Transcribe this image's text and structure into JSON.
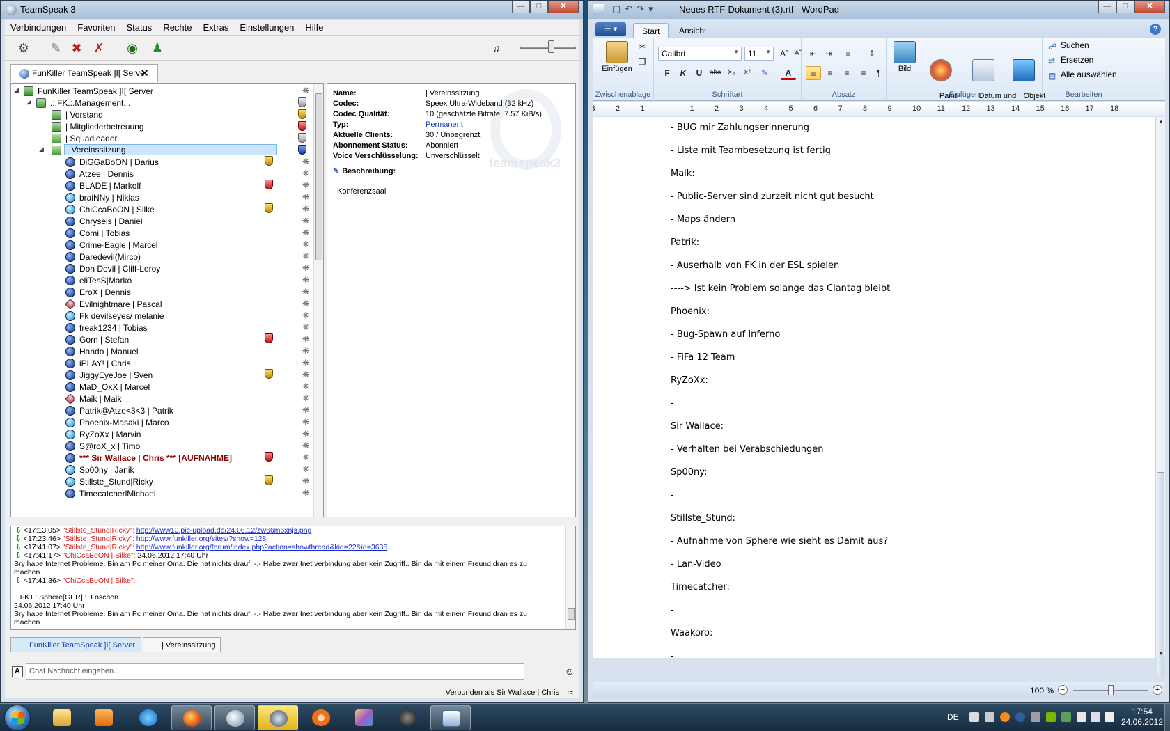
{
  "teamspeak": {
    "title": "TeamSpeak 3",
    "menu": [
      "Verbindungen",
      "Favoriten",
      "Status",
      "Rechte",
      "Extras",
      "Einstellungen",
      "Hilfe"
    ],
    "tab_label": "FunKiller TeamSpeak ]I[ Server",
    "tree": {
      "server": "FunKiller TeamSpeak ]I[ Server",
      "group": ".:.FK.:.Management.:.",
      "channels": [
        "| Vorstand",
        "| Mitgliederbetreuung",
        "| Squadleader",
        "| Vereinssitzung"
      ],
      "users": [
        {
          "name": "DiGGaBoON | Darius",
          "badge": "gold",
          "status": "normal"
        },
        {
          "name": "Atzee | Dennis",
          "badge": "",
          "status": "normal"
        },
        {
          "name": "BLADE | Markolf",
          "badge": "red",
          "status": "normal"
        },
        {
          "name": "braiNNy | Niklas",
          "badge": "",
          "status": "talk"
        },
        {
          "name": "ChiCcaBoON | Silke",
          "badge": "gold",
          "status": "talk"
        },
        {
          "name": "Chryseis | Daniel",
          "badge": "",
          "status": "normal"
        },
        {
          "name": "Comi | Tobias",
          "badge": "",
          "status": "normal"
        },
        {
          "name": "Crime-Eagle | Marcel",
          "badge": "",
          "status": "normal"
        },
        {
          "name": "Daredevil(Mirco)",
          "badge": "",
          "status": "normal"
        },
        {
          "name": "Don Devil | Cliff-Leroy",
          "badge": "",
          "status": "normal"
        },
        {
          "name": "eliTesS|Marko",
          "badge": "",
          "status": "normal"
        },
        {
          "name": "EroX | Dennis",
          "badge": "",
          "status": "normal"
        },
        {
          "name": "Evilnightmare | Pascal",
          "badge": "",
          "status": "away"
        },
        {
          "name": "Fk devilseyes/ melanie",
          "badge": "",
          "status": "talk"
        },
        {
          "name": "freak1234 | Tobias",
          "badge": "",
          "status": "normal"
        },
        {
          "name": "Gorn | Stefan",
          "badge": "red",
          "status": "normal"
        },
        {
          "name": "Hando | Manuel",
          "badge": "",
          "status": "normal"
        },
        {
          "name": "iPLAY! | Chris",
          "badge": "",
          "status": "normal"
        },
        {
          "name": "JiggyEyeJoe | Sven",
          "badge": "gold",
          "status": "normal"
        },
        {
          "name": "MaD_OxX | Marcel",
          "badge": "",
          "status": "normal"
        },
        {
          "name": "Maik | Maik",
          "badge": "",
          "status": "away"
        },
        {
          "name": "Patrik@Atze<3<3 | Patrik",
          "badge": "",
          "status": "normal"
        },
        {
          "name": "Phoenix-Masaki |  Marco",
          "badge": "",
          "status": "talk"
        },
        {
          "name": "RyZoXx | Marvin",
          "badge": "",
          "status": "talk"
        },
        {
          "name": "S@roX_x | Timo",
          "badge": "",
          "status": "normal"
        },
        {
          "name": "*** Sir Wallace | Chris *** [AUFNAHME]",
          "badge": "red",
          "status": "normal"
        },
        {
          "name": "Sp00ny | Janik",
          "badge": "",
          "status": "talk"
        },
        {
          "name": "Stillste_Stund|Ricky",
          "badge": "gold",
          "status": "talk"
        },
        {
          "name": "TimecatcherlMichael",
          "badge": "",
          "status": "normal"
        }
      ]
    },
    "info": {
      "rows": [
        {
          "k": "Name:",
          "v": "| Vereinssitzung"
        },
        {
          "k": "Codec:",
          "v": "Speex Ultra-Wideband (32 kHz)"
        },
        {
          "k": "Codec Qualität:",
          "v": "10 (geschätzte Bitrate: 7.57 KiB/s)"
        },
        {
          "k": "Typ:",
          "v": "Permanent"
        },
        {
          "k": "Aktuelle Clients:",
          "v": "30 / Unbegrenzt"
        },
        {
          "k": "Abonnement Status:",
          "v": "Abonniert"
        },
        {
          "k": "Voice Verschlüsselung:",
          "v": "Unverschlüsselt"
        }
      ],
      "logo_text": "teamspeak3",
      "desc_label": "Beschreibung:",
      "desc_text": "Konferenzsaal"
    },
    "chat": {
      "lines": [
        {
          "time": "<17:13:05>",
          "who": "\"Stillste_Stund|Ricky\":",
          "link": "http://www10.pic-upload.de/24.06.12/zw66m6xnjs.png",
          "text": ""
        },
        {
          "time": "<17:23:46>",
          "who": "\"Stillste_Stund|Ricky\":",
          "link": "http://www.funkiller.org/sites/?show=128",
          "text": ""
        },
        {
          "time": "<17:41:07>",
          "who": "\"Stillste_Stund|Ricky\":",
          "link": "http://www.funkiller.org/forum/index.php?action=showthread&kid=22&id=3635",
          "text": ""
        },
        {
          "time": "<17:41:17>",
          "who": "\"ChiCcaBoON | Silke\":",
          "link": "",
          "text": "24.06.2012 17:40 Uhr"
        }
      ],
      "plain1": "Sry habe Internet Probleme. Bin am Pc meiner Oma. Die hat nichts drauf. -.- Habe zwar Inet verbindung aber kein Zugriff.. Bin da mit einem Freund dran es zu",
      "plain2": "machen.",
      "line5_time": "<17:41:36>",
      "line5_who": "\"ChiCcaBoON | Silke\":",
      "plain3": ".:.FKT.:.Sphere[GER].:. Löschen",
      "plain4": "24.06.2012 17:40 Uhr",
      "plain5": "Sry habe Internet Probleme. Bin am Pc meiner Oma. Die hat nichts drauf. -.- Habe zwar Inet verbindung aber kein Zugriff.. Bin da mit einem Freund dran es zu",
      "plain6": "machen.",
      "tab_server": "FunKiller TeamSpeak ]I[ Server",
      "tab_channel": "| Vereinssitzung",
      "input_placeholder": "Chat Nachricht eingeben..."
    },
    "status": "Verbunden als Sir Wallace | Chris"
  },
  "wordpad": {
    "title": "Neues RTF-Dokument (3).rtf - WordPad",
    "tabs": [
      "Start",
      "Ansicht"
    ],
    "groups": {
      "clipboard": {
        "label": "Zwischenablage",
        "paste": "Einfügen"
      },
      "font": {
        "label": "Schriftart",
        "family": "Calibri",
        "size": "11"
      },
      "paragraph": {
        "label": "Absatz"
      },
      "insert": {
        "label": "Einfügen",
        "image": "Bild",
        "paint": "Paint-\nZeichnung",
        "datetime": "Datum und\nUhrzeit",
        "object": "Objekt\neinfügen"
      },
      "edit": {
        "label": "Bearbeiten",
        "find": "Suchen",
        "replace": "Ersetzen",
        "select_all": "Alle auswählen"
      }
    },
    "font_buttons": [
      "F",
      "K",
      "U",
      "abc",
      "X₂",
      "X²"
    ],
    "ruler": [
      "3",
      "2",
      "1",
      "1",
      "2",
      "3",
      "4",
      "5",
      "6",
      "7",
      "8",
      "9",
      "10",
      "11",
      "12",
      "13",
      "14",
      "15",
      "16",
      "17",
      "18"
    ],
    "document": [
      "- BUG mir Zahlungserinnerung",
      "- Liste mit Teambesetzung ist fertig",
      "Maik:",
      "- Public-Server sind zurzeit nicht gut besucht",
      "- Maps ändern",
      "Patrik:",
      "- Auserhalb von FK in der ESL spielen",
      "----> Ist kein Problem solange das Clantag bleibt",
      "Phoenix:",
      "- Bug-Spawn auf Inferno",
      "- FiFa 12 Team",
      "RyZoXx:",
      "-",
      "Sir Wallace:",
      "- Verhalten bei Verabschiedungen",
      "Sp00ny:",
      "-",
      "Stillste_Stund:",
      "- Aufnahme von Sphere wie sieht es Damit aus?",
      "- Lan-Video",
      "Timecatcher:",
      "-",
      "Waakoro:",
      "-"
    ],
    "zoom": "100 %",
    "zoom_level": 0.5
  },
  "taskbar": {
    "lang": "DE",
    "time": "17:54",
    "date": "24.06.2012",
    "apps": [
      "explorer",
      "media-player",
      "internet-explorer",
      "firefox",
      "teamspeak",
      "steam",
      "origin",
      "game",
      "headset",
      "wordpad"
    ]
  }
}
